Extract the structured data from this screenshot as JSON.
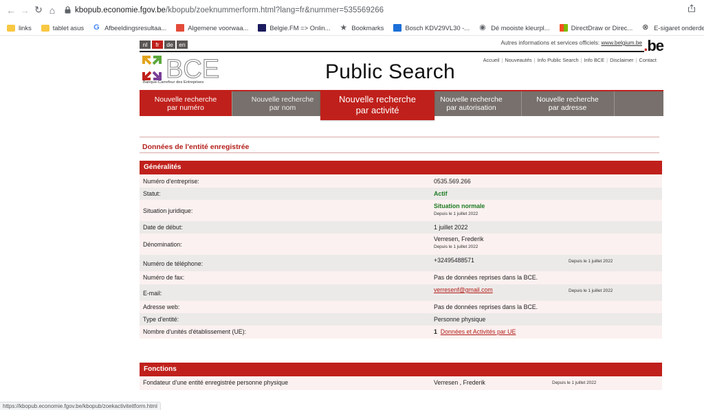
{
  "browser": {
    "url_host": "kbopub.economie.fgov.be",
    "url_path": "/kbopub/zoeknummerform.html?lang=fr&nummer=535569266",
    "bookmarks": [
      {
        "label": "links",
        "icon": "folder-icon"
      },
      {
        "label": "tablet asus",
        "icon": "folder-icon"
      },
      {
        "label": "Afbeeldingsresultaa...",
        "icon": "google-icon"
      },
      {
        "label": "Algemene voorwaa...",
        "icon": "pdf-icon"
      },
      {
        "label": "Belgie.FM => Onlin...",
        "icon": "fm-icon"
      },
      {
        "label": "Bookmarks",
        "icon": "star-icon"
      },
      {
        "label": "Bosch KDV29VL30 -...",
        "icon": "bosch-icon"
      },
      {
        "label": "Dé mooiste kleurpl...",
        "icon": "globe-icon"
      },
      {
        "label": "DirectDraw or Direc...",
        "icon": "microsoft-icon"
      },
      {
        "label": "E-sigaret onderdele...",
        "icon": "ecig-icon"
      }
    ],
    "status_url": "https://kbopub.economie.fgov.be/kbopub/zoekactiviteitform.html"
  },
  "header": {
    "langs": [
      "nl",
      "fr",
      "de",
      "en"
    ],
    "active_lang": "fr",
    "official_text": "Autres informations et services officiels:",
    "official_link": "www.belgium.be",
    "be_logo": "be",
    "logo_text": "BCE",
    "logo_subtitle": "Banque-Carrefour des Entreprises",
    "title": "Public Search",
    "top_links": [
      "Accueil",
      "Nouveautés",
      "Info Public Search",
      "Info BCE",
      "Disclaimer",
      "Contact"
    ]
  },
  "tabs": [
    {
      "line1": "Nouvelle recherche",
      "line2": "par numéro"
    },
    {
      "line1": "Nouvelle recherche",
      "line2": "par nom"
    },
    {
      "line1": "Nouvelle recherche",
      "line2": "par activité"
    },
    {
      "line1": "Nouvelle recherche",
      "line2": "par autorisation"
    },
    {
      "line1": "Nouvelle recherche",
      "line2": "par adresse"
    }
  ],
  "section_title": "Données de l'entité enregistrée",
  "generalites": {
    "title": "Généralités",
    "rows": [
      {
        "label": "Numéro d'entreprise:",
        "value": "0535.569.266"
      },
      {
        "label": "Statut:",
        "value": "Actif"
      },
      {
        "label": "Situation juridique:",
        "value": "Situation normale",
        "sub": "Depuis le 1 juillet 2022"
      },
      {
        "label": "Date de début:",
        "value": "1 juillet 2022"
      },
      {
        "label": "Dénomination:",
        "value": "Verresen, Frederik",
        "sub": "Depuis le 1 juillet 2022"
      },
      {
        "label": "Numéro de téléphone:",
        "value": "+32495488571",
        "since": "Depuis le 1 juillet 2022"
      },
      {
        "label": "Numéro de fax:",
        "value": "Pas de données reprises dans la BCE."
      },
      {
        "label": "E-mail:",
        "value": "verresenf@gmail.com",
        "since": "Depuis le 1 juillet 2022"
      },
      {
        "label": "Adresse web:",
        "value": "Pas de données reprises dans la BCE."
      },
      {
        "label": "Type d'entité:",
        "value": "Personne physique"
      },
      {
        "label": "Nombre d'unités d'établissement (UE):",
        "count": "1",
        "link": "Données et Activités par UE"
      }
    ]
  },
  "fonctions": {
    "title": "Fonctions",
    "row": {
      "label": "Fondateur d'une entité enregistrée personne physique",
      "value": "Verresen ,  Frederik",
      "since": "Depuis le 1 juillet 2022"
    }
  },
  "colors": {
    "brand_red": "#c0201b",
    "tab_grey": "#77706c",
    "active_green": "#1d7a22"
  }
}
